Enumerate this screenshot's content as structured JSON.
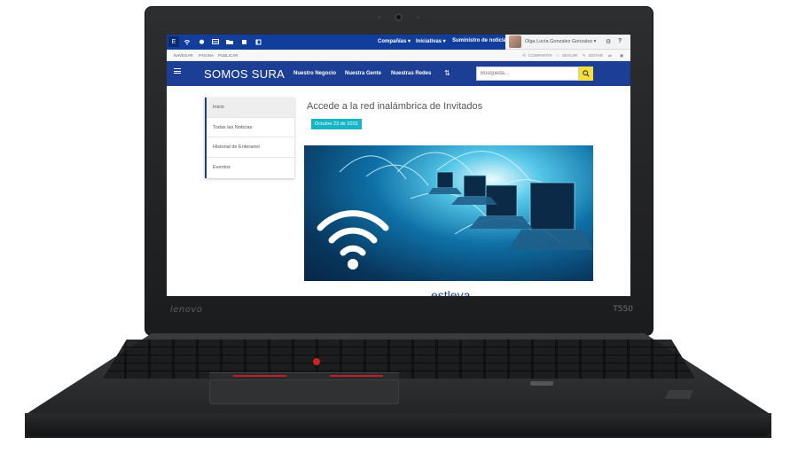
{
  "laptop": {
    "brand": "lenovo",
    "model": "T550"
  },
  "topbar": {
    "menus": [
      "Compañías ▾",
      "Iniciativas ▾",
      "Suministro de noticias"
    ],
    "user_name": "Olga Lucía Gonzalez Gonzalez ▾"
  },
  "ribbon": {
    "tabs": [
      "NAVEGAR",
      "PÁGINA",
      "PUBLICAR"
    ],
    "actions": [
      "COMPARTIR",
      "SEGUIR",
      "EDITAR"
    ]
  },
  "header": {
    "site_title": "SOMOS SURA",
    "nav": [
      "Nuestro Negocio",
      "Nuestra Gente",
      "Nuestras Redes"
    ],
    "search_placeholder": "Búsqueda..."
  },
  "sidebar": {
    "items": [
      "Inicio",
      "Todas las Noticias",
      "Historial de Enteranet",
      "Eventos"
    ]
  },
  "article": {
    "title": "Accede a la red inalámbrica de Invitados",
    "date": "Octubre 23 de 2015",
    "partial_heading": "estleva"
  },
  "colors": {
    "header_blue": "#1c3f95",
    "topbar_blue": "#113e9c",
    "badge_cyan": "#16b6c6",
    "search_yellow": "#f4e03b"
  }
}
